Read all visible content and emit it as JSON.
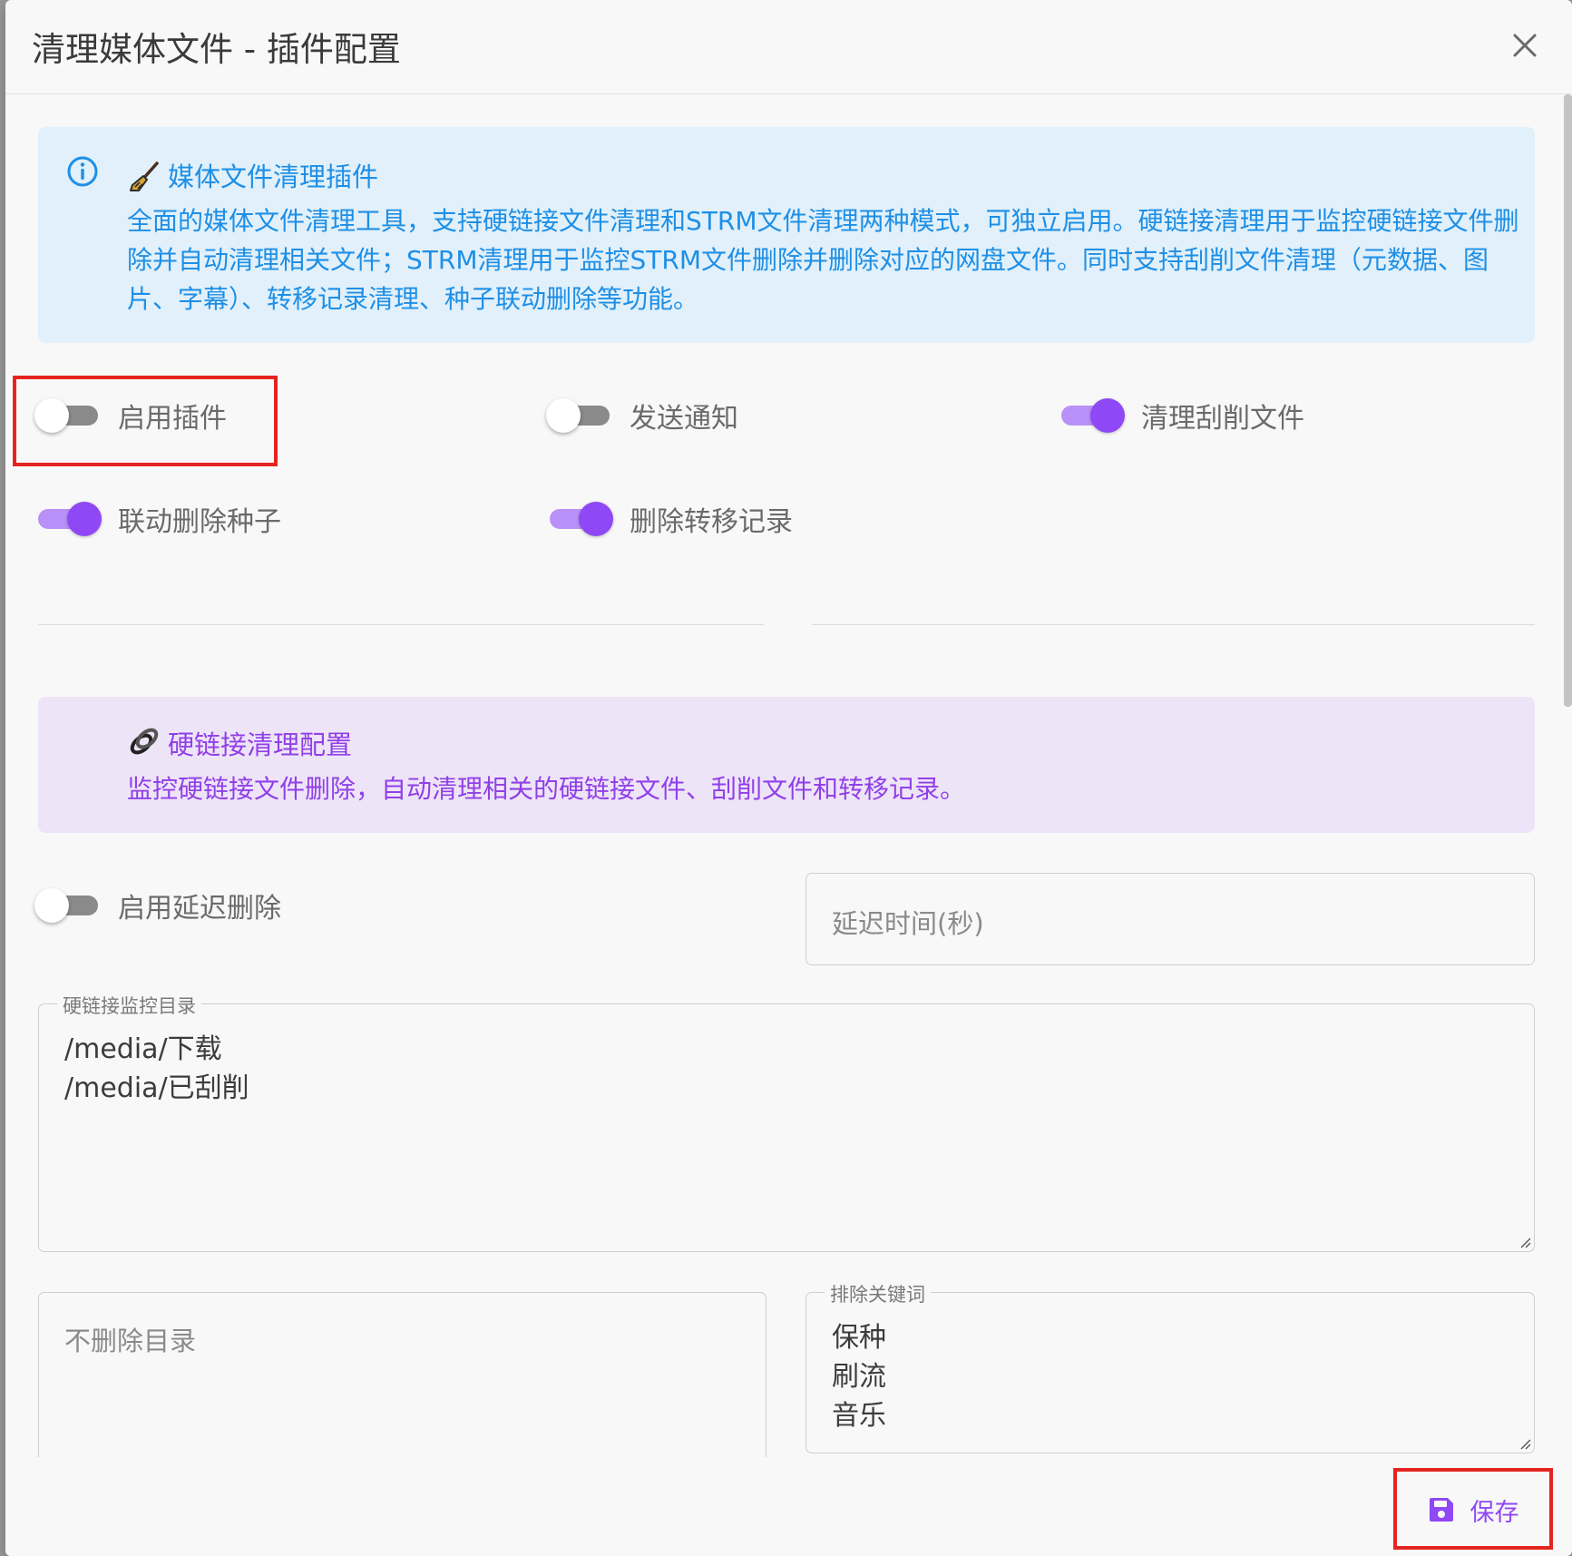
{
  "dialog": {
    "title": "清理媒体文件 - 插件配置"
  },
  "info_alert": {
    "icon": "info-circle-icon",
    "emoji_icon": "broom-icon",
    "title": "媒体文件清理插件",
    "body": "全面的媒体文件清理工具，支持硬链接文件清理和STRM文件清理两种模式，可独立启用。硬链接清理用于监控硬链接文件删除并自动清理相关文件；STRM清理用于监控STRM文件删除并删除对应的网盘文件。同时支持刮削文件清理（元数据、图片、字幕）、转移记录清理、种子联动删除等功能。",
    "color": "#1e8fe6"
  },
  "switches": {
    "enable_plugin": {
      "label": "启用插件",
      "on": false
    },
    "send_notify": {
      "label": "发送通知",
      "on": false
    },
    "clean_scrap": {
      "label": "清理刮削文件",
      "on": true
    },
    "delete_torrent": {
      "label": "联动删除种子",
      "on": true
    },
    "delete_history": {
      "label": "删除转移记录",
      "on": true
    },
    "delay_delete": {
      "label": "启用延迟删除",
      "on": false
    }
  },
  "hardlink_alert": {
    "emoji_icon": "link-icon",
    "title": "硬链接清理配置",
    "body": "监控硬链接文件删除，自动清理相关的硬链接文件、刮削文件和转移记录。",
    "color": "#9040e8"
  },
  "fields": {
    "delay_seconds": {
      "placeholder": "延迟时间(秒)"
    },
    "monitor_dirs": {
      "label": "硬链接监控目录",
      "lines": [
        "/media/下载",
        "/media/已刮削"
      ]
    },
    "exclude_dirs": {
      "placeholder": "不删除目录"
    },
    "exclude_keywords": {
      "label": "排除关键词",
      "lines": [
        "保种",
        "刷流",
        "音乐"
      ]
    }
  },
  "footer": {
    "save_label": "保存",
    "save_icon": "floppy-disk-icon"
  },
  "colors": {
    "accent": "#8f48f5",
    "highlight": "#e52420"
  }
}
